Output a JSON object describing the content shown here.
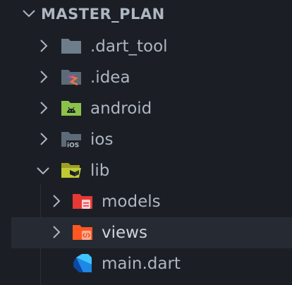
{
  "explorer": {
    "root": {
      "label": "MASTER_PLAN",
      "expanded": true
    },
    "items": [
      {
        "label": ".dart_tool",
        "icon": "folder-icon",
        "expanded": false
      },
      {
        "label": ".idea",
        "icon": "idea-folder-icon",
        "expanded": false
      },
      {
        "label": "android",
        "icon": "android-folder-icon",
        "expanded": false
      },
      {
        "label": "ios",
        "icon": "ios-folder-icon",
        "expanded": false
      },
      {
        "label": "lib",
        "icon": "lib-folder-open-icon",
        "expanded": true
      },
      {
        "label": "models",
        "icon": "models-folder-icon",
        "expanded": false
      },
      {
        "label": "views",
        "icon": "views-folder-icon",
        "expanded": false,
        "selected": true
      },
      {
        "label": "main.dart",
        "icon": "dart-file-icon"
      }
    ]
  },
  "colors": {
    "background": "#1b1f25",
    "selected_row": "#262b33",
    "text": "#aeb6c1",
    "folder_gray": "#6e7d8a",
    "android_green": "#8bc34a",
    "lib_folder": "#c0ca33",
    "models_red": "#e53935",
    "views_orange": "#ff5722",
    "dart_blue": "#1e88e5"
  }
}
